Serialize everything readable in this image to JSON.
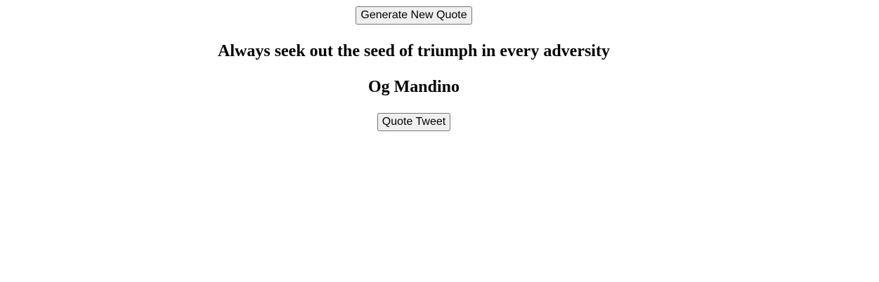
{
  "controls": {
    "generate_label": "Generate New Quote",
    "tweet_label": "Quote Tweet"
  },
  "quote": {
    "text": "Always seek out the seed of triumph in every adversity",
    "author": "Og Mandino"
  }
}
